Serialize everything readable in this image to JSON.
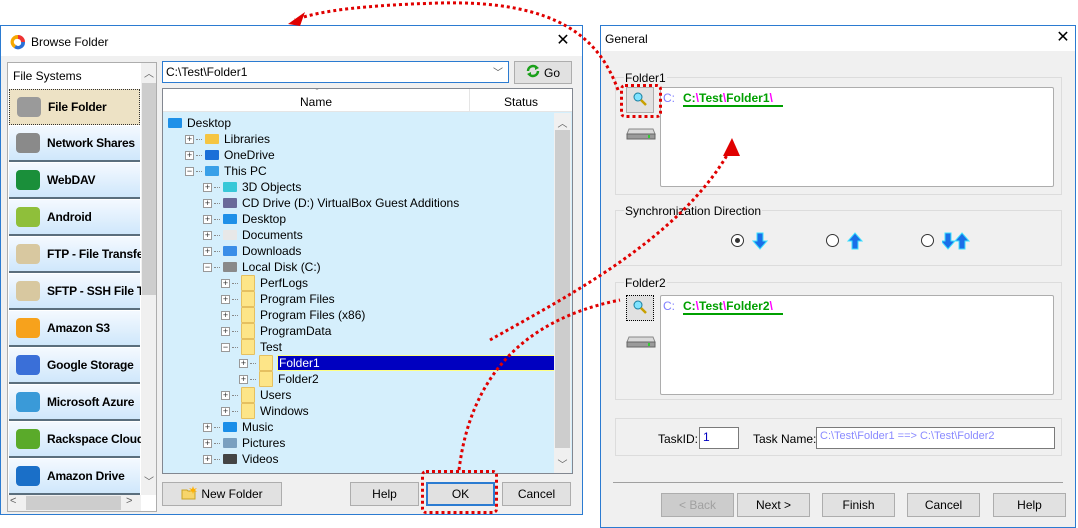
{
  "browse_folder": {
    "title": "Browse Folder",
    "close_glyph": "✕",
    "file_systems_header": "File Systems",
    "providers": [
      {
        "label": "File Folder",
        "icon": "hard-drive-icon",
        "selected": true
      },
      {
        "label": "Network Shares",
        "icon": "network-drive-icon",
        "selected": false
      },
      {
        "label": "WebDAV",
        "icon": "globe-icon",
        "selected": false
      },
      {
        "label": "Android",
        "icon": "android-icon",
        "selected": false
      },
      {
        "label": "FTP - File Transfer",
        "icon": "ftp-server-icon",
        "selected": false
      },
      {
        "label": "SFTP - SSH File Transfer",
        "icon": "sftp-server-icon",
        "selected": false
      },
      {
        "label": "Amazon S3",
        "icon": "amazon-s3-icon",
        "selected": false
      },
      {
        "label": "Google Storage",
        "icon": "google-icon",
        "selected": false
      },
      {
        "label": "Microsoft Azure",
        "icon": "azure-icon",
        "selected": false
      },
      {
        "label": "Rackspace Cloud",
        "icon": "rackspace-icon",
        "selected": false
      },
      {
        "label": "Amazon Drive",
        "icon": "amazon-drive-icon",
        "selected": false
      }
    ],
    "path_value": "C:\\Test\\Folder1",
    "go_label": "Go",
    "columns": {
      "name": "Name",
      "status": "Status"
    },
    "tree": [
      {
        "label": "Desktop",
        "level": 0,
        "expander": "",
        "icon": "desktop-icon"
      },
      {
        "label": "Libraries",
        "level": 1,
        "expander": "+",
        "icon": "libraries-icon"
      },
      {
        "label": "OneDrive",
        "level": 1,
        "expander": "+",
        "icon": "onedrive-icon"
      },
      {
        "label": "This PC",
        "level": 1,
        "expander": "−",
        "icon": "computer-icon"
      },
      {
        "label": "3D Objects",
        "level": 2,
        "expander": "+",
        "icon": "3d-objects-icon"
      },
      {
        "label": "CD Drive (D:) VirtualBox Guest Additions",
        "level": 2,
        "expander": "+",
        "icon": "cd-drive-icon"
      },
      {
        "label": "Desktop",
        "level": 2,
        "expander": "+",
        "icon": "desktop-icon"
      },
      {
        "label": "Documents",
        "level": 2,
        "expander": "+",
        "icon": "documents-icon"
      },
      {
        "label": "Downloads",
        "level": 2,
        "expander": "+",
        "icon": "downloads-icon"
      },
      {
        "label": "Local Disk (C:)",
        "level": 2,
        "expander": "−",
        "icon": "local-disk-icon"
      },
      {
        "label": "PerfLogs",
        "level": 3,
        "expander": "+",
        "icon": "folder-icon"
      },
      {
        "label": "Program Files",
        "level": 3,
        "expander": "+",
        "icon": "folder-icon"
      },
      {
        "label": "Program Files (x86)",
        "level": 3,
        "expander": "+",
        "icon": "folder-icon"
      },
      {
        "label": "ProgramData",
        "level": 3,
        "expander": "+",
        "icon": "folder-icon"
      },
      {
        "label": "Test",
        "level": 3,
        "expander": "−",
        "icon": "folder-icon"
      },
      {
        "label": "Folder1",
        "level": 4,
        "expander": "+",
        "icon": "folder-icon",
        "selected": true
      },
      {
        "label": "Folder2",
        "level": 4,
        "expander": "+",
        "icon": "folder-icon"
      },
      {
        "label": "Users",
        "level": 3,
        "expander": "+",
        "icon": "folder-icon"
      },
      {
        "label": "Windows",
        "level": 3,
        "expander": "+",
        "icon": "folder-icon"
      },
      {
        "label": "Music",
        "level": 2,
        "expander": "+",
        "icon": "music-icon"
      },
      {
        "label": "Pictures",
        "level": 2,
        "expander": "+",
        "icon": "pictures-icon"
      },
      {
        "label": "Videos",
        "level": 2,
        "expander": "+",
        "icon": "videos-icon"
      }
    ],
    "buttons": {
      "new_folder": "New Folder",
      "help": "Help",
      "ok": "OK",
      "cancel": "Cancel"
    }
  },
  "general": {
    "title": "General",
    "close_glyph": "✕",
    "folder1": {
      "label": "Folder1",
      "drive": "C:",
      "path_parts": [
        "C:",
        "Test",
        "Folder1",
        ""
      ]
    },
    "sync_direction": {
      "label": "Synchronization Direction",
      "options": [
        {
          "value": "left-to-right",
          "icon": "arrow-down-icon",
          "checked": true
        },
        {
          "value": "right-to-left",
          "icon": "arrow-up-icon",
          "checked": false
        },
        {
          "value": "bidirectional",
          "icon": "arrow-both-icon",
          "checked": false
        }
      ]
    },
    "folder2": {
      "label": "Folder2",
      "drive": "C:",
      "path_parts": [
        "C:",
        "Test",
        "Folder2",
        ""
      ]
    },
    "task_id_label": "TaskID:",
    "task_id_value": "1",
    "task_name_label": "Task Name:",
    "task_name_value": "C:\\Test\\Folder1 ==> C:\\Test\\Folder2",
    "buttons": {
      "back": "< Back",
      "next": "Next >",
      "finish": "Finish",
      "cancel": "Cancel",
      "help": "Help"
    }
  },
  "colors": {
    "accent": "#2b7bd1",
    "selection": "#0000c0",
    "tree_bg": "#d5effc",
    "path_green": "#00a000",
    "separator_magenta": "#ff00ff",
    "drive_purple": "#8080ff",
    "annotation_red": "#e00000"
  }
}
